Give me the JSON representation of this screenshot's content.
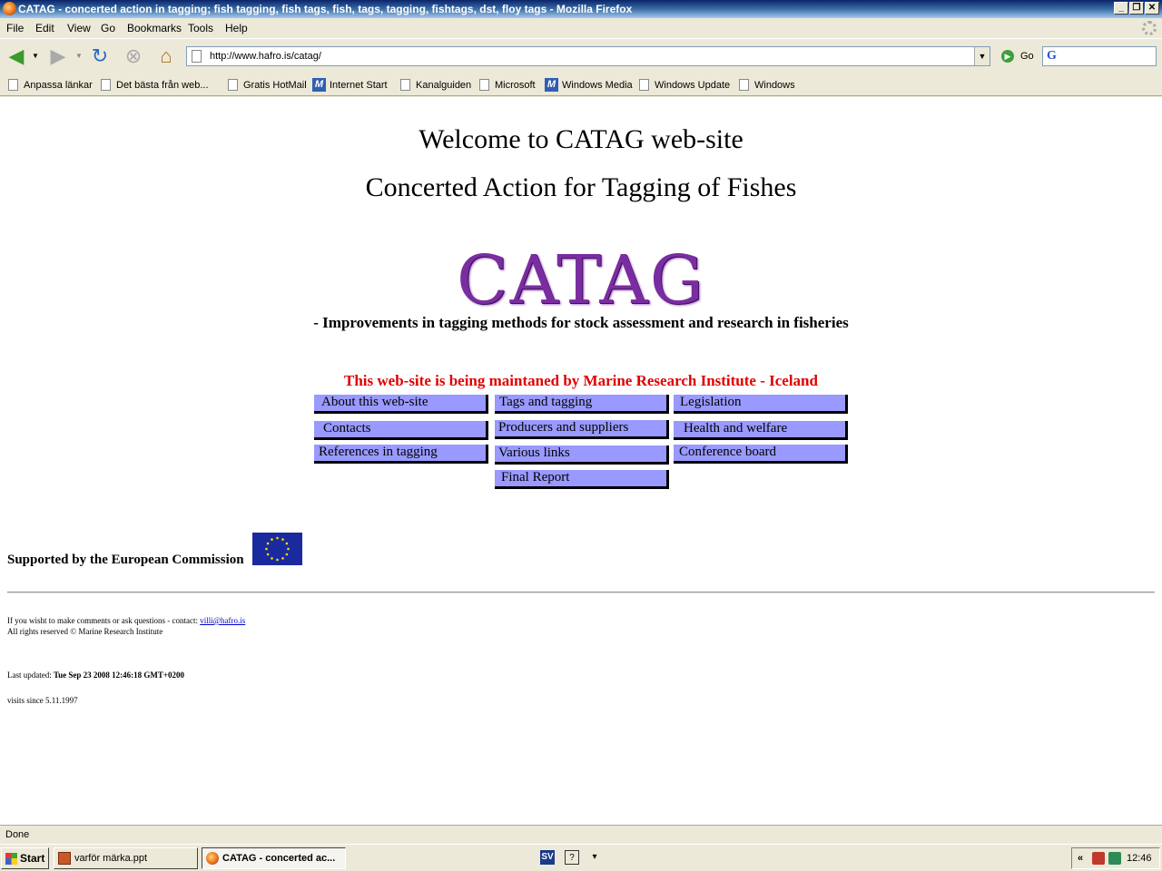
{
  "window": {
    "title": "CATAG - concerted action in tagging; fish tagging, fish tags, fish, tags, tagging, fishtags, dst, floy tags - Mozilla Firefox",
    "minimize": "_",
    "restore": "❐",
    "close": "✕"
  },
  "menu": [
    "File",
    "Edit",
    "View",
    "Go",
    "Bookmarks",
    "Tools",
    "Help"
  ],
  "nav": {
    "url": "http://www.hafro.is/catag/",
    "go_label": "Go"
  },
  "bookmarks": [
    "Anpassa länkar",
    "Det bästa från web...",
    "Gratis HotMail",
    "Internet Start",
    "Kanalguiden",
    "Microsoft",
    "Windows Media",
    "Windows Update",
    "Windows"
  ],
  "page": {
    "heading1": "Welcome to CATAG web-site",
    "heading2": "Concerted Action for Tagging of Fishes",
    "logo": "CATAG",
    "tagline": "- Improvements in tagging methods for stock assessment and research in fisheries",
    "maintained": "This web-site is being maintaned by Marine Research Institute - Iceland",
    "links": [
      "About this web-site",
      "Tags and tagging",
      "Legislation",
      "Contacts",
      "Producers and suppliers",
      "Health and welfare",
      "References in tagging",
      "Various links",
      "Conference board",
      "Final Report"
    ],
    "support": "Supported by the European Commission",
    "contact_text": "If you wisht to make comments or ask questions - contact:",
    "contact_email": "villi@hafro.is",
    "rights": "All rights reserved © Marine Research Institute",
    "last_updated_label": "Last updated:",
    "last_updated_value": "Tue Sep 23 2008 12:46:18 GMT+0200",
    "visits": "visits since 5.11.1997"
  },
  "status": "Done",
  "taskbar": {
    "start": "Start",
    "tasks": [
      "varför märka.ppt",
      "CATAG - concerted ac..."
    ],
    "lang": "SV",
    "clock": "12:46"
  }
}
